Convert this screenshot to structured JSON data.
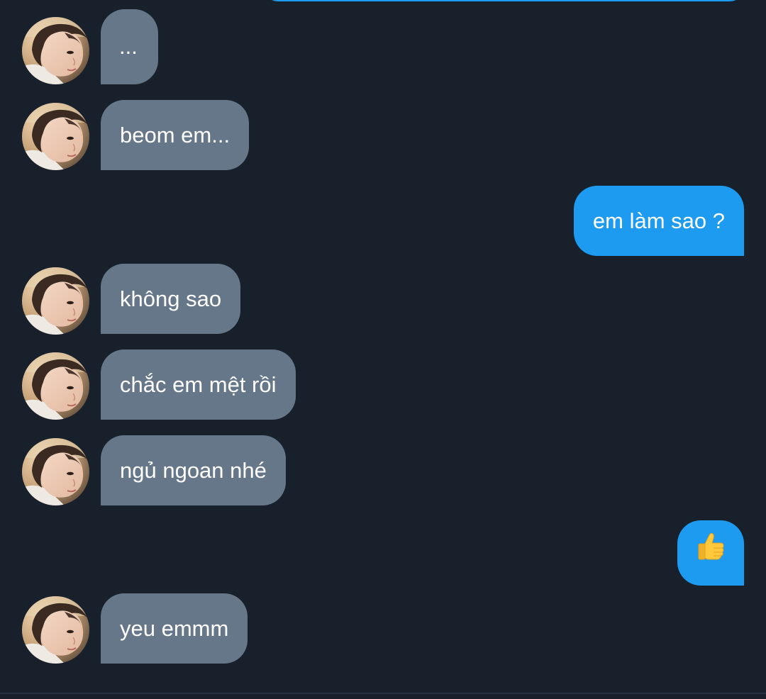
{
  "conversation": {
    "messages": [
      {
        "sender": "them",
        "text": "..."
      },
      {
        "sender": "them",
        "text": "beom em..."
      },
      {
        "sender": "me",
        "text": "em làm sao ?"
      },
      {
        "sender": "them",
        "text": "không sao"
      },
      {
        "sender": "them",
        "text": "chắc em mệt rồi"
      },
      {
        "sender": "them",
        "text": "ngủ ngoan nhé"
      },
      {
        "sender": "me",
        "icon": "thumbs-up-icon"
      },
      {
        "sender": "them",
        "text": "yeu emmm"
      }
    ]
  },
  "colors": {
    "background": "#17202b",
    "incoming_bubble": "#66778a",
    "outgoing_bubble": "#1d9bf0",
    "text": "#ffffff"
  }
}
